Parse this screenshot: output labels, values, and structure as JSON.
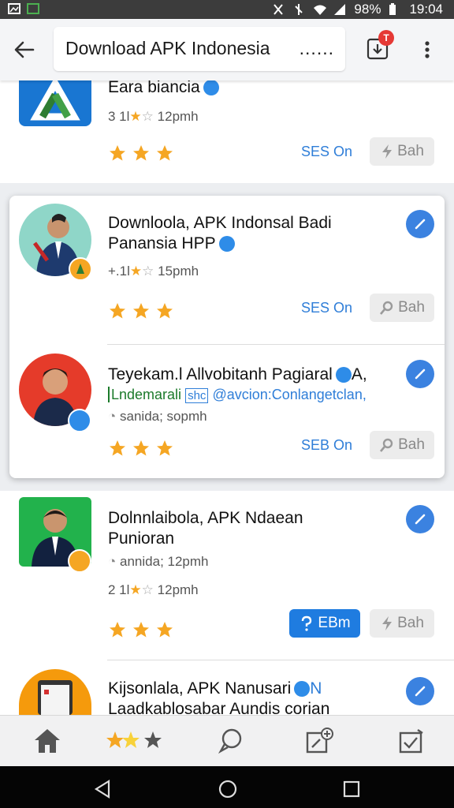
{
  "status_bar": {
    "battery": "98%",
    "time": "19:04"
  },
  "header": {
    "title": "Download APK Indonesia",
    "overflow_dots": "......",
    "notification_badge": "T"
  },
  "apps": [
    {
      "name": "Eara biancia",
      "rating_line": "3 1l",
      "rating_suffix": "12pmh",
      "ses_label": "SES On",
      "action_label": "Bah",
      "stars": 3
    },
    {
      "name_line1": "Downloola, APK Indonsal Badi",
      "name_line2": "Panansia HPP",
      "rating_line": "+.1l",
      "rating_suffix": "15pmh",
      "ses_label": "SES On",
      "action_label": "Bah",
      "stars": 3
    },
    {
      "name": "Teyekam.l Allvobitanh Pagiaral",
      "name_suffix": "A,",
      "sub_highlight": "Lndemarali",
      "sub_tag": "shc",
      "sub_rest": "@avcion:Conlangetclan,",
      "meta": "sanida; sopmh",
      "ses_label": "SEB On",
      "action_label": "Bah",
      "stars": 3
    },
    {
      "name_line1": "Dolnnlaibola, APK Ndaean",
      "name_line2": "Punioran",
      "meta": "annida; 12pmh",
      "rating_line": "2 1l",
      "rating_suffix": "12pmh",
      "primary_label": "EBm",
      "action_label": "Bah",
      "stars": 3
    },
    {
      "name_line1": "Kijsonlala,  APK Nanusari",
      "name_suffix": "N",
      "name_line2": "Laadkablosabar Aundis corian"
    }
  ],
  "colors": {
    "accent": "#2f7ed8",
    "star": "#f5a623",
    "primary_button": "#1f7ce0"
  },
  "bottom_nav": [
    "home-icon",
    "stars-icon",
    "chat-icon",
    "add-note-icon",
    "task-icon"
  ]
}
